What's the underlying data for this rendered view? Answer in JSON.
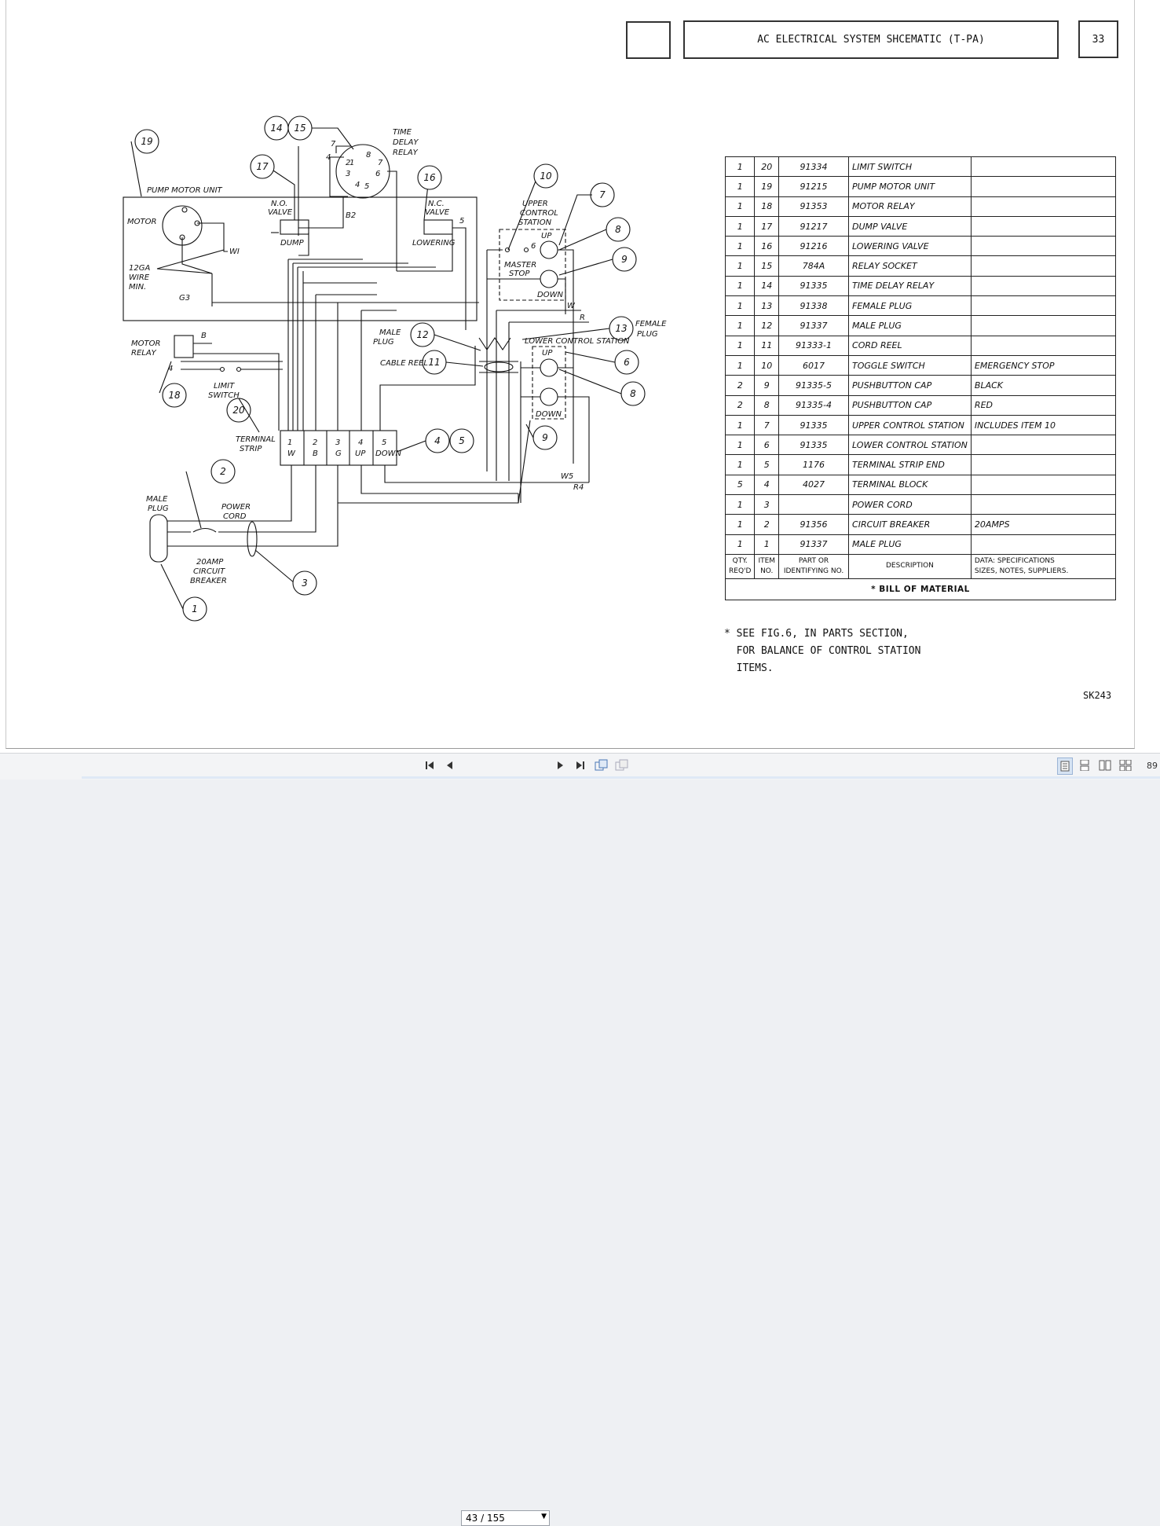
{
  "header": {
    "title": "AC ELECTRICAL SYSTEM SHCEMATIC (T-PA)",
    "page_number": "33"
  },
  "schematic": {
    "labels": {
      "pump_motor_unit": "PUMP MOTOR UNIT",
      "motor": "MOTOR",
      "wire_1": "12GA",
      "wire_2": "WIRE",
      "wire_3": "MIN.",
      "time_delay_1": "TIME",
      "time_delay_2": "DELAY",
      "time_delay_3": "RELAY",
      "no_valve_1": "N.O.",
      "no_valve_2": "VALVE",
      "dump": "DUMP",
      "nc_valve_1": "N.C.",
      "nc_valve_2": "VALVE",
      "lowering": "LOWERING",
      "upper_1": "UPPER",
      "upper_2": "CONTROL",
      "upper_3": "STATION",
      "master_1": "MASTER",
      "master_2": "STOP",
      "up": "UP",
      "down": "DOWN",
      "motor_relay_1": "MOTOR",
      "motor_relay_2": "RELAY",
      "limit_1": "LIMIT",
      "limit_2": "SWITCH",
      "male_plug_mid_1": "MALE",
      "male_plug_mid_2": "PLUG",
      "cable_reel": "CABLE REEL",
      "lower_control": "LOWER CONTROL STATION",
      "female_1": "FEMALE",
      "female_2": "PLUG",
      "up_low": "UP",
      "down_low": "DOWN",
      "terminal_1": "TERMINAL",
      "terminal_2": "STRIP",
      "male_plug_1": "MALE",
      "male_plug_2": "PLUG",
      "power_1": "POWER",
      "power_2": "CORD",
      "breaker_1": "20AMP",
      "breaker_2": "CIRCUIT",
      "breaker_3": "BREAKER",
      "w_wi": "WI",
      "w_g3": "G3",
      "w_b2": "B2",
      "w_b": "B",
      "w_5": "5",
      "w_6": "6",
      "w_w": "W",
      "w_r": "R",
      "w_w5": "W5",
      "w_r4": "R4",
      "w_4": "4",
      "t1": "1",
      "t1w": "W",
      "t2": "2",
      "t2w": "B",
      "t3": "3",
      "t3w": "G",
      "t4": "4",
      "t4w": "UP",
      "t5": "5",
      "t5w": "DOWN",
      "r1": "1",
      "r2": "2",
      "r3": "3",
      "r4": "4",
      "r5": "5",
      "r6": "6",
      "r7": "7",
      "r8": "8",
      "r7o": "7",
      "r4o": "4"
    },
    "callouts": [
      "19",
      "14",
      "15",
      "17",
      "16",
      "10",
      "7",
      "8",
      "9",
      "12",
      "11",
      "13",
      "6",
      "8",
      "9",
      "18",
      "20",
      "4",
      "5",
      "2",
      "3",
      "1"
    ]
  },
  "bom": {
    "rows": [
      {
        "qty": "1",
        "item": "20",
        "part": "91334",
        "desc": "LIMIT SWITCH",
        "data": ""
      },
      {
        "qty": "1",
        "item": "19",
        "part": "91215",
        "desc": "PUMP MOTOR UNIT",
        "data": ""
      },
      {
        "qty": "1",
        "item": "18",
        "part": "91353",
        "desc": "MOTOR RELAY",
        "data": ""
      },
      {
        "qty": "1",
        "item": "17",
        "part": "91217",
        "desc": "DUMP VALVE",
        "data": ""
      },
      {
        "qty": "1",
        "item": "16",
        "part": "91216",
        "desc": "LOWERING VALVE",
        "data": ""
      },
      {
        "qty": "1",
        "item": "15",
        "part": "784A",
        "desc": "RELAY SOCKET",
        "data": ""
      },
      {
        "qty": "1",
        "item": "14",
        "part": "91335",
        "desc": "TIME DELAY RELAY",
        "data": ""
      },
      {
        "qty": "1",
        "item": "13",
        "part": "91338",
        "desc": "FEMALE PLUG",
        "data": ""
      },
      {
        "qty": "1",
        "item": "12",
        "part": "91337",
        "desc": "MALE PLUG",
        "data": ""
      },
      {
        "qty": "1",
        "item": "11",
        "part": "91333-1",
        "desc": "CORD REEL",
        "data": ""
      },
      {
        "qty": "1",
        "item": "10",
        "part": "6017",
        "desc": "TOGGLE SWITCH",
        "data": "EMERGENCY STOP"
      },
      {
        "qty": "2",
        "item": "9",
        "part": "91335-5",
        "desc": "PUSHBUTTON CAP",
        "data": "BLACK"
      },
      {
        "qty": "2",
        "item": "8",
        "part": "91335-4",
        "desc": "PUSHBUTTON CAP",
        "data": "RED"
      },
      {
        "qty": "1",
        "item": "7",
        "part": "91335",
        "desc": "UPPER CONTROL STATION",
        "data": "INCLUDES ITEM 10"
      },
      {
        "qty": "1",
        "item": "6",
        "part": "91335",
        "desc": "LOWER CONTROL STATION",
        "data": ""
      },
      {
        "qty": "1",
        "item": "5",
        "part": "1176",
        "desc": "TERMINAL STRIP END",
        "data": ""
      },
      {
        "qty": "5",
        "item": "4",
        "part": "4027",
        "desc": "TERMINAL BLOCK",
        "data": ""
      },
      {
        "qty": "1",
        "item": "3",
        "part": "",
        "desc": "POWER CORD",
        "data": ""
      },
      {
        "qty": "1",
        "item": "2",
        "part": "91356",
        "desc": "CIRCUIT BREAKER",
        "data": "20AMPS"
      },
      {
        "qty": "1",
        "item": "1",
        "part": "91337",
        "desc": "MALE PLUG",
        "data": ""
      }
    ],
    "headers": {
      "qty_1": "QTY.",
      "qty_2": "REQ'D",
      "item_1": "ITEM",
      "item_2": "NO.",
      "part_1": "PART OR",
      "part_2": "IDENTIFYING NO.",
      "desc": "DESCRIPTION",
      "data_1": "DATA: SPECIFICATIONS",
      "data_2": "SIZES, NOTES, SUPPLIERS."
    },
    "footer": "BILL OF MATERIAL",
    "footer_star": "*"
  },
  "notes": {
    "line1": "* SEE FIG.6, IN PARTS SECTION,",
    "line2": "  FOR BALANCE OF CONTROL STATION",
    "line3": "  ITEMS.",
    "drawing_number": "SK243"
  },
  "toolbar": {
    "first_icon": "first-page-icon",
    "prev_icon": "previous-page-icon",
    "page_value": "43 / 155",
    "next_icon": "next-page-icon",
    "last_icon": "last-page-icon",
    "zoom": "89"
  }
}
